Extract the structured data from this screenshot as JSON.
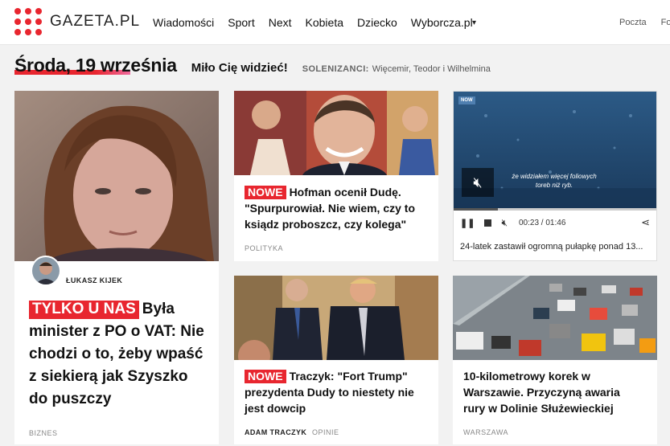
{
  "header": {
    "logo_text": "GAZETA.PL",
    "nav": [
      "Wiadomości",
      "Sport",
      "Next",
      "Kobieta",
      "Dziecko",
      "Wyborcza.pl"
    ],
    "more_symbol": "▾",
    "right_links": [
      "Poczta",
      "Fo"
    ]
  },
  "dateline": {
    "date": "Środa, 19 września",
    "greeting": "Miło Cię widzieć!",
    "solenizanci_label": "SOLENIZANCI:",
    "solenizanci_names": "Więcemir, Teodor i Wilhelmina"
  },
  "cards": {
    "main": {
      "author": "ŁUKASZ KIJEK",
      "badge": "TYLKO U NAS",
      "headline": "Była minister z PO o VAT: Nie chodzi o to, żeby wpaść z siekierą jak Szyszko do puszczy",
      "section": "BIZNES"
    },
    "duda": {
      "badge": "NOWE",
      "headline": "Hofman ocenił Dudę. \"Spurpurowiał. Nie wiem, czy to ksiądz proboszcz, czy kolega\"",
      "section": "POLITYKA"
    },
    "video": {
      "channel_badge": "NOW",
      "subtitle": "że widziałem więcej foliowych toreb niż ryb.",
      "time": "00:23 / 01:46",
      "progress": 0.22,
      "title": "24-latek zastawił ogromną pułapkę ponad 13..."
    },
    "trump": {
      "badge": "NOWE",
      "headline": "Traczyk: \"Fort Trump\" prezydenta Dudy to niestety nie jest dowcip",
      "author": "ADAM TRACZYK",
      "section": "OPINIE"
    },
    "traffic": {
      "headline": "10-kilometrowy korek w Warszawie. Przyczyną awaria rury w Dolinie Służewieckiej",
      "section": "WARSZAWA"
    }
  },
  "colors": {
    "brand_red": "#e8262f",
    "pink": "#f06a9e"
  }
}
